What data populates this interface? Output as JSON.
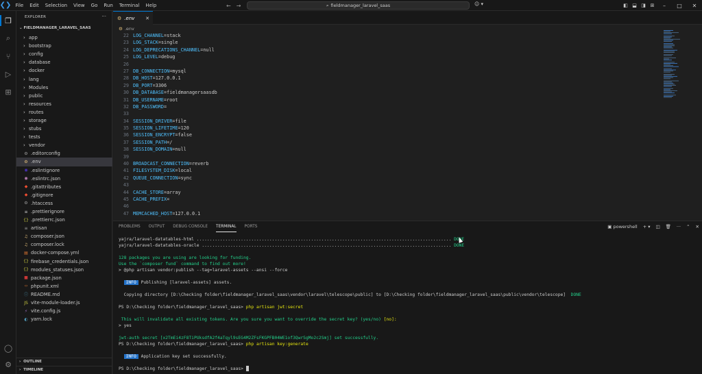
{
  "titlebar": {
    "menu": [
      "File",
      "Edit",
      "Selection",
      "View",
      "Go",
      "Run",
      "Terminal",
      "Help"
    ],
    "search_text": "fieldmanager_laravel_saas"
  },
  "sidebar": {
    "title": "EXPLORER",
    "folder": "FIELDMANAGER_LARAVEL_SAAS",
    "items": [
      {
        "label": "app",
        "type": "folder"
      },
      {
        "label": "bootstrap",
        "type": "folder"
      },
      {
        "label": "config",
        "type": "folder"
      },
      {
        "label": "database",
        "type": "folder"
      },
      {
        "label": "docker",
        "type": "folder"
      },
      {
        "label": "lang",
        "type": "folder"
      },
      {
        "label": "Modules",
        "type": "folder"
      },
      {
        "label": "public",
        "type": "folder"
      },
      {
        "label": "resources",
        "type": "folder"
      },
      {
        "label": "routes",
        "type": "folder"
      },
      {
        "label": "storage",
        "type": "folder"
      },
      {
        "label": "stubs",
        "type": "folder"
      },
      {
        "label": "tests",
        "type": "folder"
      },
      {
        "label": "vendor",
        "type": "folder"
      },
      {
        "label": ".editorconfig",
        "type": "file",
        "icon": "gear-icon",
        "color": "#9d9d9d"
      },
      {
        "label": ".env",
        "type": "file",
        "icon": "gear-icon",
        "color": "#e5c07b"
      },
      {
        "label": ".eslintignore",
        "type": "file",
        "icon": "eslint-icon",
        "color": "#4b32c3"
      },
      {
        "label": ".eslintrc.json",
        "type": "file",
        "icon": "eslint-icon",
        "color": "#c586c0"
      },
      {
        "label": ".gitattributes",
        "type": "file",
        "icon": "git-icon",
        "color": "#f14e32"
      },
      {
        "label": ".gitignore",
        "type": "file",
        "icon": "git-icon",
        "color": "#f14e32"
      },
      {
        "label": ".htaccess",
        "type": "file",
        "icon": "gear-icon",
        "color": "#9d9d9d"
      },
      {
        "label": ".prettierignore",
        "type": "file",
        "icon": "prettier-icon",
        "color": "#cccccc"
      },
      {
        "label": ".prettierrc.json",
        "type": "file",
        "icon": "json-icon",
        "color": "#cbcb41"
      },
      {
        "label": "artisan",
        "type": "file",
        "icon": "lines-icon",
        "color": "#9d9d9d"
      },
      {
        "label": "composer.json",
        "type": "file",
        "icon": "composer-icon",
        "color": "#e5c07b"
      },
      {
        "label": "composer.lock",
        "type": "file",
        "icon": "composer-icon",
        "color": "#e5c07b"
      },
      {
        "label": "docker-compose.yml",
        "type": "file",
        "icon": "docker-icon",
        "color": "#e37933"
      },
      {
        "label": "firebase_credentials.json",
        "type": "file",
        "icon": "json-icon",
        "color": "#cbcb41"
      },
      {
        "label": "modules_statuses.json",
        "type": "file",
        "icon": "json-icon",
        "color": "#cbcb41"
      },
      {
        "label": "package.json",
        "type": "file",
        "icon": "npm-icon",
        "color": "#cb3837"
      },
      {
        "label": "phpunit.xml",
        "type": "file",
        "icon": "xml-icon",
        "color": "#e37933"
      },
      {
        "label": "README.md",
        "type": "file",
        "icon": "info-icon",
        "color": "#519aba"
      },
      {
        "label": "vite-module-loader.js",
        "type": "file",
        "icon": "js-icon",
        "color": "#cbcb41"
      },
      {
        "label": "vite.config.js",
        "type": "file",
        "icon": "vite-icon",
        "color": "#a074c4"
      },
      {
        "label": "yarn.lock",
        "type": "file",
        "icon": "yarn-icon",
        "color": "#519aba"
      }
    ],
    "outline": "OUTLINE",
    "timeline": "TIMELINE"
  },
  "editor": {
    "tab_label": ".env",
    "breadcrumb": ".env",
    "lines": [
      {
        "n": "22",
        "k": "LOG_CHANNEL",
        "v": "stack"
      },
      {
        "n": "23",
        "k": "LOG_STACK",
        "v": "single"
      },
      {
        "n": "24",
        "k": "LOG_DEPRECATIONS_CHANNEL",
        "v": "null"
      },
      {
        "n": "25",
        "k": "LOG_LEVEL",
        "v": "debug"
      },
      {
        "n": "26",
        "k": "",
        "v": ""
      },
      {
        "n": "27",
        "k": "DB_CONNECTION",
        "v": "mysql"
      },
      {
        "n": "28",
        "k": "DB_HOST",
        "v": "127.0.0.1"
      },
      {
        "n": "29",
        "k": "DB_PORT",
        "v": "3306"
      },
      {
        "n": "30",
        "k": "DB_DATABASE",
        "v": "fieldmanagersaasdb"
      },
      {
        "n": "31",
        "k": "DB_USERNAME",
        "v": "root"
      },
      {
        "n": "32",
        "k": "DB_PASSWORD",
        "v": ""
      },
      {
        "n": "33",
        "k": "",
        "v": ""
      },
      {
        "n": "34",
        "k": "SESSION_DRIVER",
        "v": "file"
      },
      {
        "n": "35",
        "k": "SESSION_LIFETIME",
        "v": "120"
      },
      {
        "n": "36",
        "k": "SESSION_ENCRYPT",
        "v": "false"
      },
      {
        "n": "37",
        "k": "SESSION_PATH",
        "v": "/"
      },
      {
        "n": "38",
        "k": "SESSION_DOMAIN",
        "v": "null"
      },
      {
        "n": "39",
        "k": "",
        "v": ""
      },
      {
        "n": "40",
        "k": "BROADCAST_CONNECTION",
        "v": "reverb"
      },
      {
        "n": "41",
        "k": "FILESYSTEM_DISK",
        "v": "local"
      },
      {
        "n": "42",
        "k": "QUEUE_CONNECTION",
        "v": "sync"
      },
      {
        "n": "43",
        "k": "",
        "v": ""
      },
      {
        "n": "44",
        "k": "CACHE_STORE",
        "v": "array"
      },
      {
        "n": "45",
        "k": "CACHE_PREFIX",
        "v": ""
      },
      {
        "n": "46",
        "k": "",
        "v": ""
      },
      {
        "n": "47",
        "k": "MEMCACHED_HOST",
        "v": "127.0.0.1"
      }
    ]
  },
  "panel": {
    "tabs": [
      "PROBLEMS",
      "OUTPUT",
      "DEBUG CONSOLE",
      "TERMINAL",
      "PORTS"
    ],
    "active_tab": "TERMINAL",
    "shell": "powershell",
    "terminal": {
      "pkg1": "yajra/laravel-datatables-html ..................................................................................................",
      "pkg2": "yajra/laravel-datatables-oracle ................................................................................................",
      "done": "DONE",
      "funding1": "128 packages you are using are looking for funding.",
      "funding2": "Use the `composer fund` command to find out more!",
      "publish_cmd": "> @php artisan vendor:publish --tag=laravel-assets --ansi --force",
      "info": "INFO",
      "publishing": "Publishing [laravel-assets] assets.",
      "copying": "Copying directory [D:\\Checking folder\\fieldmanager_laravel_saas\\vendor\\laravel\\telescope\\public] to [D:\\Checking folder\\fieldmanager_laravel_saas\\public\\vendor\\telescope]",
      "prompt": "PS D:\\Checking folder\\fieldmanager_laravel_saas>",
      "cmd_jwt": "php artisan jwt:secret",
      "warning": "This will invalidate all existing tokens. Are you sure you want to override the secret key? (yes/no)",
      "default_no": "[no]:",
      "answer": "> yes",
      "jwt_set": "jwt-auth secret [x2TmEi4zF8TiPUksdfA2f4aTqyl9sEG4M2ZFsFKGPFB04WE1of3QwrSgMo2c2Smj] set successfully.",
      "cmd_key": "php artisan key:generate",
      "key_set": "Application key set successfully."
    }
  },
  "colors": {
    "accent": "#0078d4",
    "key": "#4fc1ff",
    "success": "#23d18b",
    "command": "#e5e510"
  }
}
